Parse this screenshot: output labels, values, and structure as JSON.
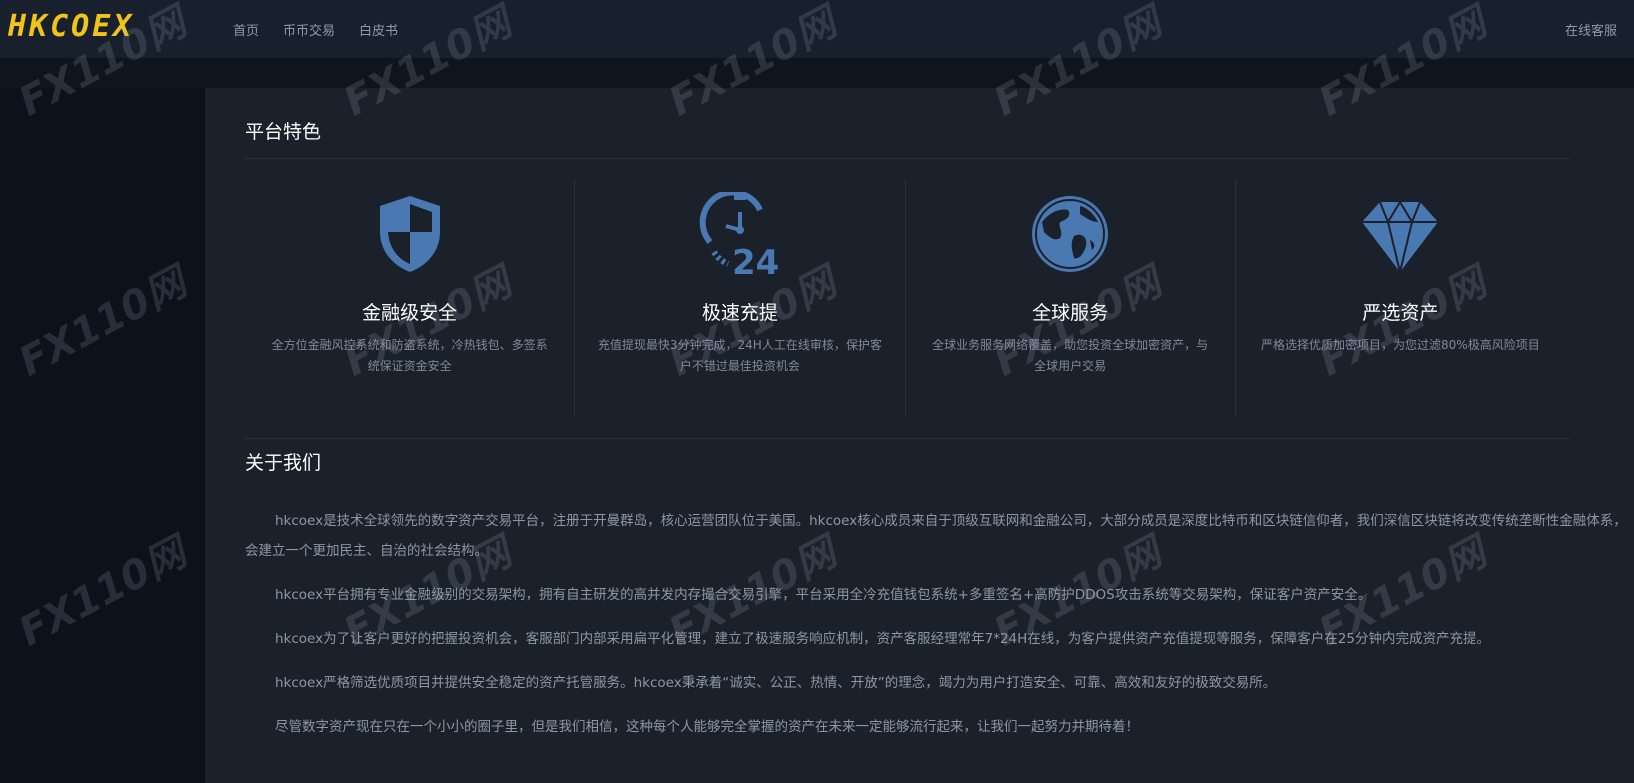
{
  "header": {
    "logo": "HKCOEX",
    "nav": [
      "首页",
      "币币交易",
      "白皮书"
    ],
    "service": "在线客服"
  },
  "features_section": {
    "title": "平台特色",
    "items": [
      {
        "icon": "shield-icon",
        "title": "金融级安全",
        "desc": "全方位金融风控系统和防盗系统，冷热钱包、多签系统保证资金安全"
      },
      {
        "icon": "clock-24-icon",
        "title": "极速充提",
        "desc": "充值提现最快3分钟完成，24H人工在线审核，保护客户不错过最佳投资机会"
      },
      {
        "icon": "globe-icon",
        "title": "全球服务",
        "desc": "全球业务服务网络覆盖，助您投资全球加密资产，与全球用户交易"
      },
      {
        "icon": "diamond-icon",
        "title": "严选资产",
        "desc": "严格选择优质加密项目，为您过滤80%极高风险项目"
      }
    ]
  },
  "about_section": {
    "title": "关于我们",
    "paragraphs": [
      "hkcoex是技术全球领先的数字资产交易平台，注册于开曼群岛，核心运营团队位于美国。hkcoex核心成员来自于顶级互联网和金融公司，大部分成员是深度比特币和区块链信仰者，我们深信区块链将改变传统垄断性金融体系，会建立一个更加民主、自治的社会结构。",
      "hkcoex平台拥有专业金融级别的交易架构，拥有自主研发的高并发内存撮合交易引擎，平台采用全冷充值钱包系统+多重签名+高防护DDOS攻击系统等交易架构，保证客户资产安全。",
      "hkcoex为了让客户更好的把握投资机会，客服部门内部采用扁平化管理，建立了极速服务响应机制，资产客服经理常年7*24H在线，为客户提供资产充值提现等服务，保障客户在25分钟内完成资产充提。",
      "hkcoex严格筛选优质项目并提供安全稳定的资产托管服务。hkcoex秉承着“诚实、公正、热情、开放”的理念，竭力为用户打造安全、可靠、高效和友好的极致交易所。",
      "尽管数字资产现在只在一个小小的圈子里，但是我们相信，这种每个人能够完全掌握的资产在未来一定能够流行起来，让我们一起努力并期待着！"
    ]
  },
  "watermark": "FX110网",
  "colors": {
    "accent_icon": "#4a78b0",
    "logo": "#f0c419",
    "panel": "#1a212b",
    "background": "#0b121b"
  }
}
